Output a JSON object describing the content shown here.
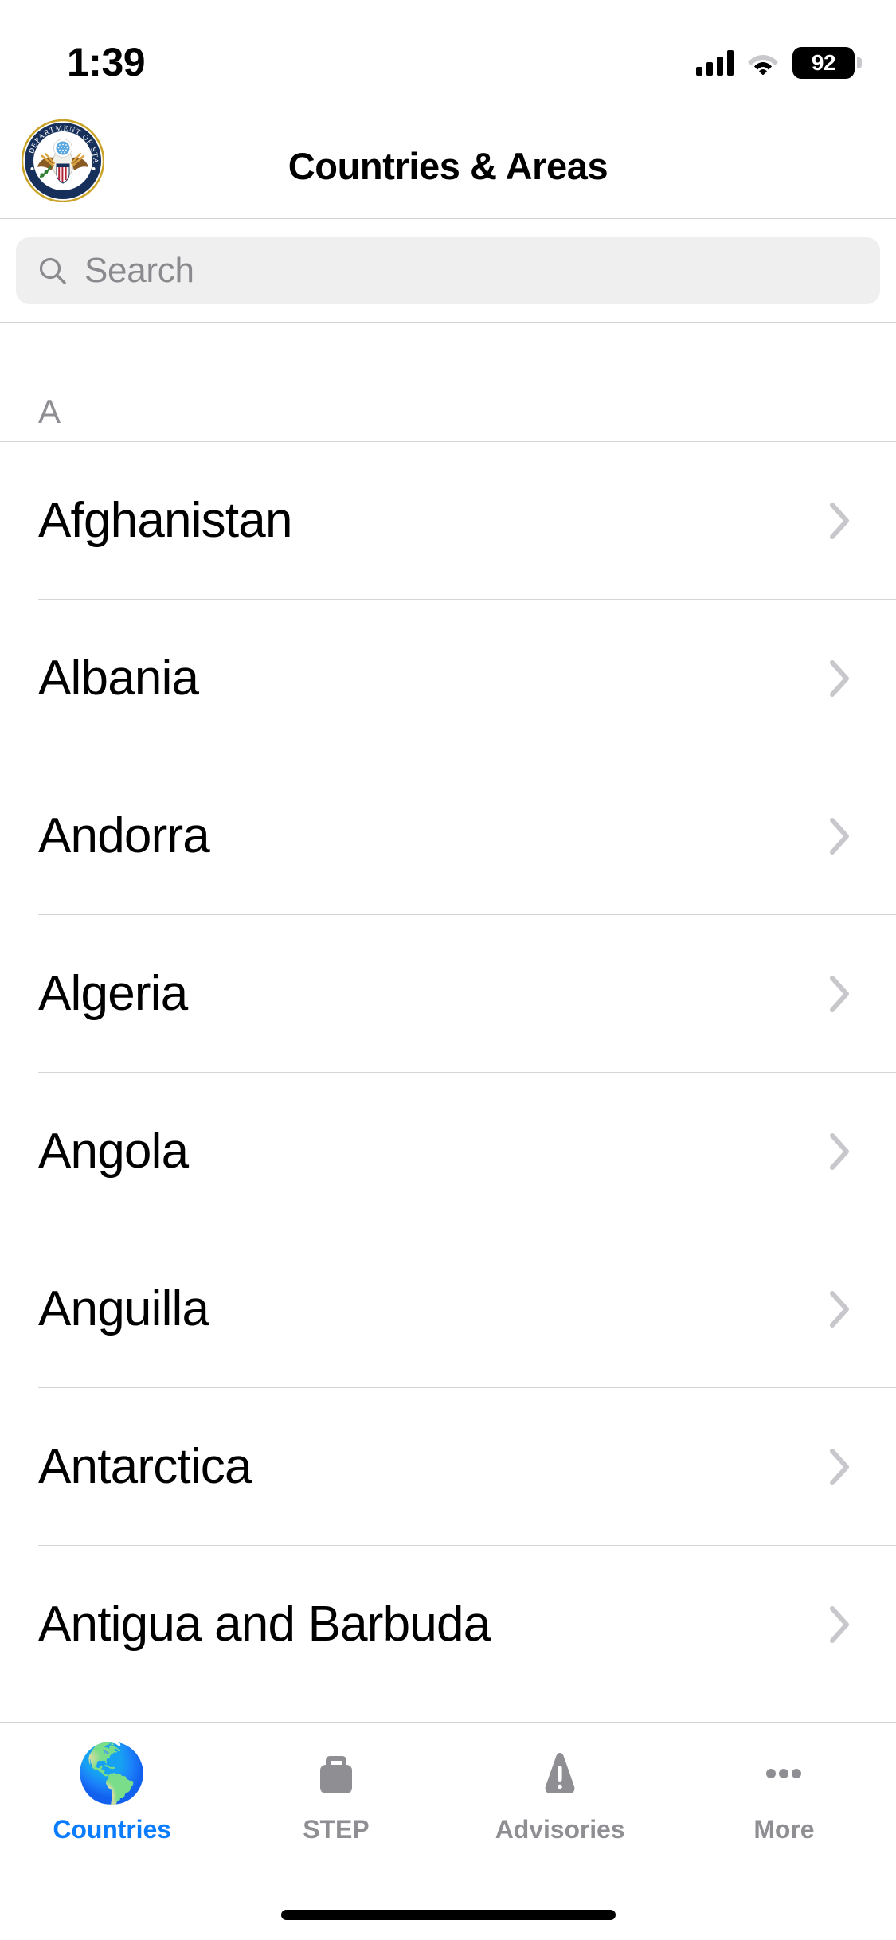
{
  "status_bar": {
    "time": "1:39",
    "cellular_icon": "cellular-bars-icon",
    "wifi_icon": "wifi-icon",
    "battery_icon": "battery-icon",
    "battery_percent": "92"
  },
  "nav": {
    "title": "Countries & Areas",
    "seal_icon": "department-of-state-seal-icon",
    "seal_text_top": "DEPARTMENT OF STATE",
    "seal_text_bottom": "UNITED STATES OF AMERICA"
  },
  "search": {
    "placeholder": "Search",
    "value": "",
    "icon": "search-icon"
  },
  "list": {
    "section_header": "A",
    "chevron_icon": "chevron-right-icon",
    "items": [
      {
        "label": "Afghanistan"
      },
      {
        "label": "Albania"
      },
      {
        "label": "Andorra"
      },
      {
        "label": "Algeria"
      },
      {
        "label": "Angola"
      },
      {
        "label": "Anguilla"
      },
      {
        "label": "Antarctica"
      },
      {
        "label": "Antigua and Barbuda"
      }
    ]
  },
  "tabbar": {
    "active_color": "#0a7cff",
    "inactive_color": "#8e8e93",
    "tabs": [
      {
        "label": "Countries",
        "icon": "globe-icon",
        "glyph": "🌎",
        "active": true
      },
      {
        "label": "STEP",
        "icon": "briefcase-icon",
        "glyph": "",
        "active": false
      },
      {
        "label": "Advisories",
        "icon": "warning-triangle-icon",
        "glyph": "",
        "active": false
      },
      {
        "label": "More",
        "icon": "ellipsis-icon",
        "glyph": "",
        "active": false
      }
    ]
  },
  "home_indicator": {
    "name": "home-indicator"
  }
}
